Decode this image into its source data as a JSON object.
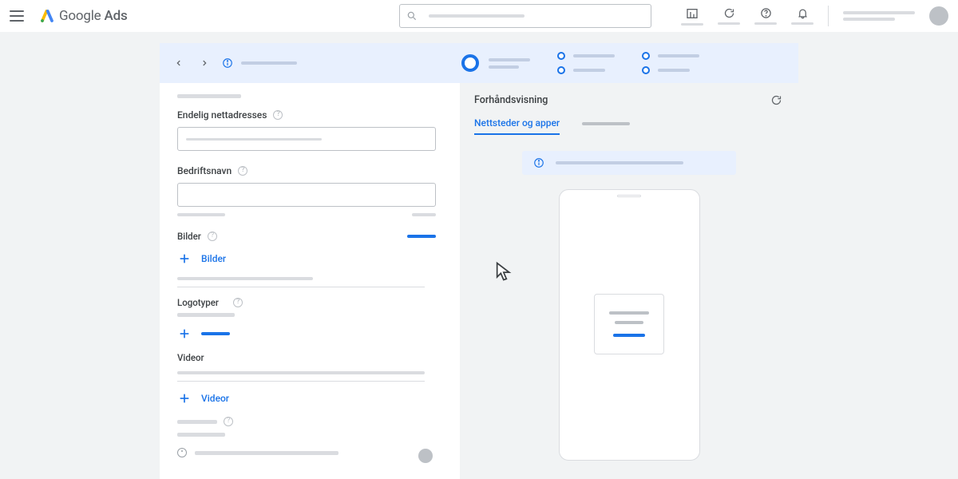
{
  "header": {
    "product_g": "Google",
    "product_a": "Ads"
  },
  "form": {
    "final_url_label": "Endelig nettadresses",
    "business_name_label": "Bedriftsnavn",
    "images_label": "Bilder",
    "add_images_label": "Bilder",
    "logos_label": "Logotyper",
    "videos_label": "Videor",
    "add_videos_label": "Videor"
  },
  "preview": {
    "title": "Forhåndsvisning",
    "tab_active": "Nettsteder og apper"
  }
}
